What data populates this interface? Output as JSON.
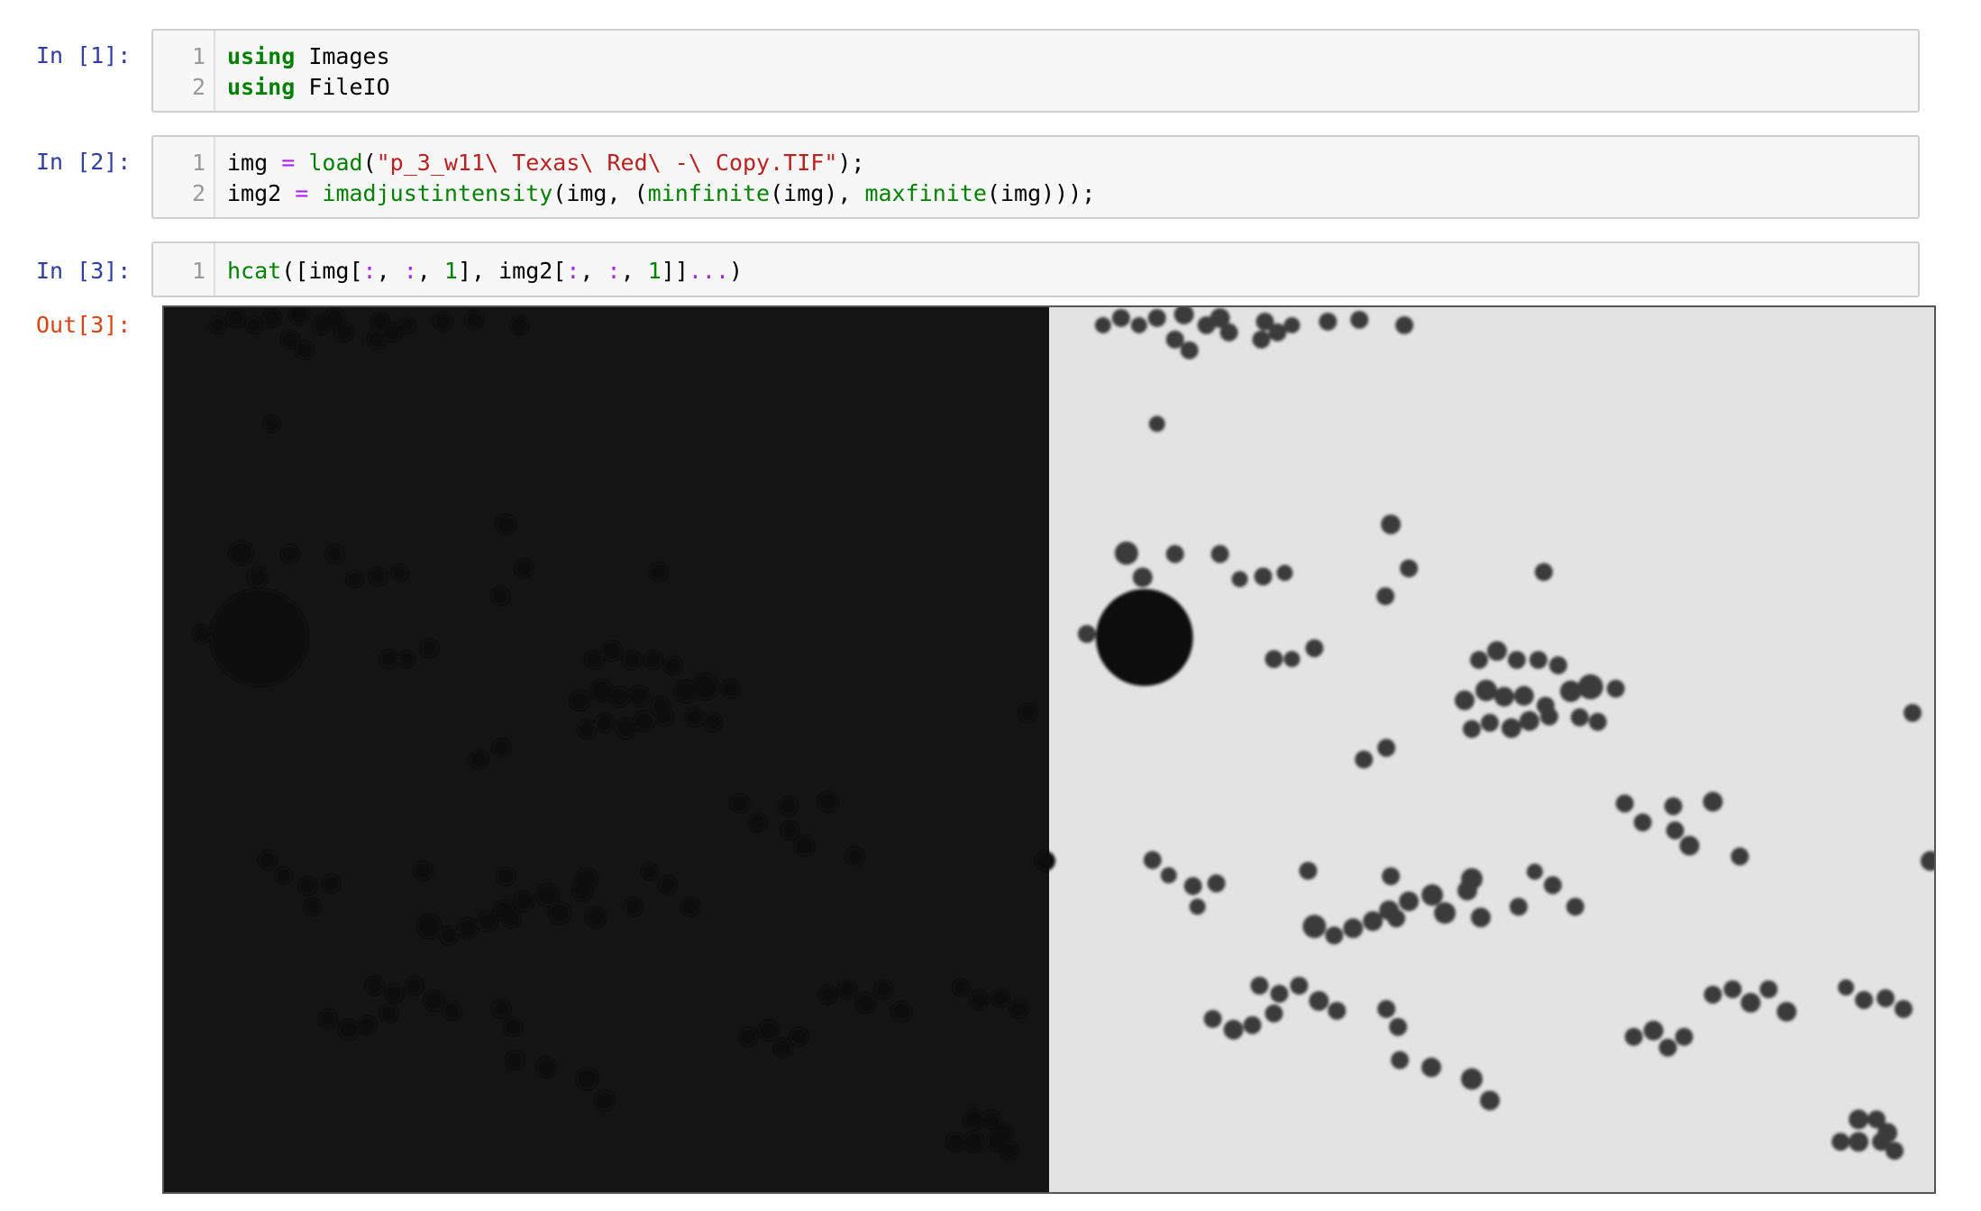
{
  "cells": [
    {
      "prompt": "In [1]:",
      "lines": [
        {
          "num": "1",
          "tokens": [
            {
              "t": "using",
              "c": "kw"
            },
            {
              "t": " Images",
              "c": ""
            }
          ]
        },
        {
          "num": "2",
          "tokens": [
            {
              "t": "using",
              "c": "kw"
            },
            {
              "t": " FileIO",
              "c": ""
            }
          ]
        }
      ]
    },
    {
      "prompt": "In [2]:",
      "lines": [
        {
          "num": "1",
          "tokens": [
            {
              "t": "img ",
              "c": ""
            },
            {
              "t": "=",
              "c": "op"
            },
            {
              "t": " ",
              "c": ""
            },
            {
              "t": "load",
              "c": "fn"
            },
            {
              "t": "(",
              "c": ""
            },
            {
              "t": "\"p_3_w11\\ Texas\\ Red\\ -\\ Copy.TIF\"",
              "c": "str"
            },
            {
              "t": ");",
              "c": ""
            }
          ]
        },
        {
          "num": "2",
          "tokens": [
            {
              "t": "img2 ",
              "c": ""
            },
            {
              "t": "=",
              "c": "op"
            },
            {
              "t": " ",
              "c": ""
            },
            {
              "t": "imadjustintensity",
              "c": "fn"
            },
            {
              "t": "(img, (",
              "c": ""
            },
            {
              "t": "minfinite",
              "c": "fn"
            },
            {
              "t": "(img), ",
              "c": ""
            },
            {
              "t": "maxfinite",
              "c": "fn"
            },
            {
              "t": "(img)));",
              "c": ""
            }
          ]
        }
      ]
    },
    {
      "prompt": "In [3]:",
      "lines": [
        {
          "num": "1",
          "tokens": [
            {
              "t": "hcat",
              "c": "fn"
            },
            {
              "t": "([img[",
              "c": ""
            },
            {
              "t": ":",
              "c": "op"
            },
            {
              "t": ", ",
              "c": ""
            },
            {
              "t": ":",
              "c": "op"
            },
            {
              "t": ", ",
              "c": ""
            },
            {
              "t": "1",
              "c": "num"
            },
            {
              "t": "], img2[",
              "c": ""
            },
            {
              "t": ":",
              "c": "op"
            },
            {
              "t": ", ",
              "c": ""
            },
            {
              "t": ":",
              "c": "op"
            },
            {
              "t": ", ",
              "c": ""
            },
            {
              "t": "1",
              "c": "num"
            },
            {
              "t": "]]",
              "c": ""
            },
            {
              "t": "...",
              "c": "op"
            },
            {
              "t": ")",
              "c": ""
            }
          ]
        }
      ]
    }
  ],
  "output": {
    "prompt": "Out[3]:"
  }
}
